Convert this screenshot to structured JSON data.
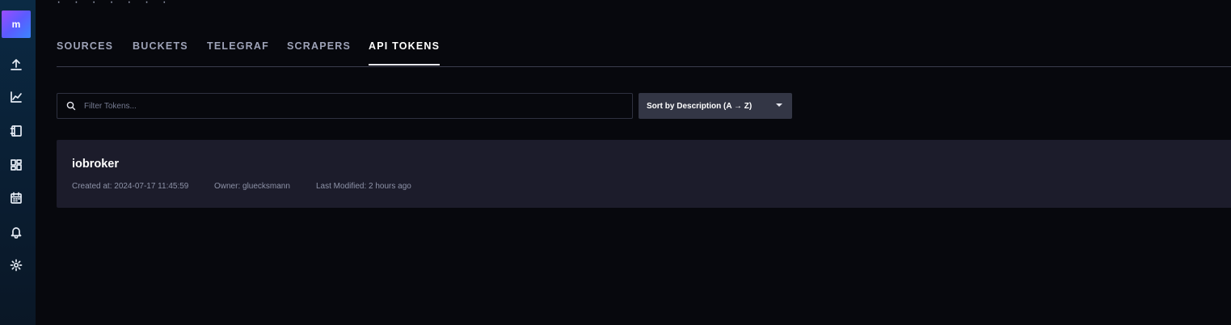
{
  "sidebar": {
    "avatar_letter": "m",
    "items": [
      {
        "icon": "upload-icon"
      },
      {
        "icon": "graph-icon"
      },
      {
        "icon": "notebook-icon"
      },
      {
        "icon": "dashboards-icon"
      },
      {
        "icon": "calendar-icon"
      },
      {
        "icon": "bell-icon"
      },
      {
        "icon": "gear-icon"
      }
    ]
  },
  "header": {
    "cropped_title": "· · · ·   · · ·"
  },
  "tabs": [
    {
      "label": "SOURCES",
      "active": false
    },
    {
      "label": "BUCKETS",
      "active": false
    },
    {
      "label": "TELEGRAF",
      "active": false
    },
    {
      "label": "SCRAPERS",
      "active": false
    },
    {
      "label": "API TOKENS",
      "active": true
    }
  ],
  "filter": {
    "placeholder": "Filter Tokens...",
    "value": ""
  },
  "sort": {
    "label": "Sort by Description (A → Z)"
  },
  "tokens": [
    {
      "name": "iobroker",
      "created": "Created at: 2024-07-17 11:45:59",
      "owner": "Owner: gluecksmann",
      "modified": "Last Modified: 2 hours ago"
    }
  ],
  "colors": {
    "background": "#07080d",
    "card": "#1c1c2b",
    "sort_button": "#333645",
    "sidebar": "#0b2a44",
    "accent_gradient_start": "#9b4dff",
    "accent_gradient_end": "#3a86ff"
  }
}
